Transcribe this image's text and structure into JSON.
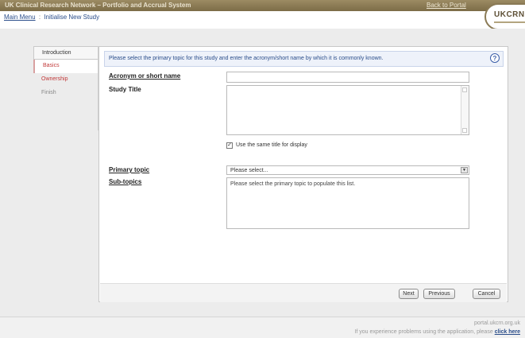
{
  "header": {
    "title": "UK Clinical Research Network – Portfolio and Accrual System",
    "back_link": "Back to Portal",
    "logo_text": "UKCRN"
  },
  "breadcrumb": {
    "main_menu": "Main Menu",
    "separator": ":",
    "current": "Initialise New Study"
  },
  "sidebar": {
    "items": [
      {
        "label": "Introduction"
      },
      {
        "label": "Basics"
      },
      {
        "label": "Ownership"
      },
      {
        "label": "Finish"
      }
    ]
  },
  "form": {
    "instruction": "Please select the primary topic for this study and enter the acronym/short name by which it is commonly known.",
    "acronym_label": "Acronym or short name",
    "acronym_value": "",
    "study_title_label": "Study Title",
    "study_title_value": "",
    "same_title_label": "Use the same title for display",
    "same_title_checked": true,
    "primary_topic_label": "Primary topic",
    "primary_topic_value": "Please select...",
    "sub_topics_label": "Sub-topics",
    "sub_topics_placeholder": "Please select the primary topic to populate this list."
  },
  "buttons": {
    "next": "Next",
    "previous": "Previous",
    "cancel": "Cancel"
  },
  "footer": {
    "url": "portal.ukcrn.org.uk",
    "help_text": "If you experience problems using the application, please",
    "help_link": "click here"
  },
  "colors": {
    "header_bg": "#8c7b55",
    "link": "#2a4d8a",
    "nav_active": "#c23a3a"
  }
}
